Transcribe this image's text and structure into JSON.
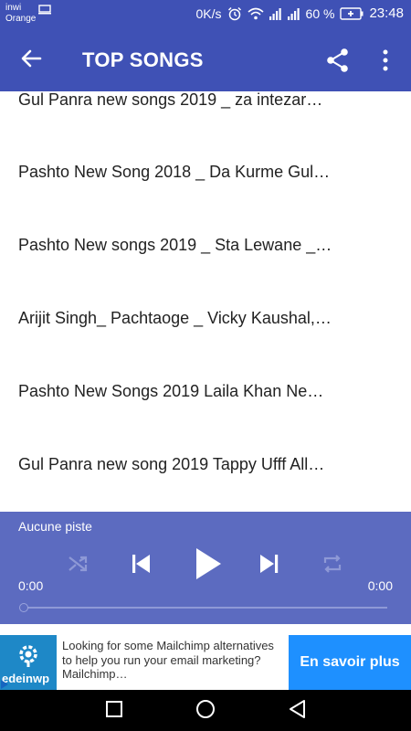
{
  "status_bar": {
    "carrier_line1": "inwi",
    "carrier_line2": "Orange",
    "network_speed": "0K/s",
    "battery": "60 %",
    "time": "23:48",
    "icons": [
      "screen-icon",
      "alarm-icon",
      "wifi-icon",
      "signal-icon",
      "signal-icon",
      "battery-icon"
    ]
  },
  "app_bar": {
    "title": "TOP SONGS",
    "back_icon": "arrow-left-icon",
    "share_icon": "share-icon",
    "more_icon": "more-vert-icon"
  },
  "songs": [
    "Gul Panra new songs 2019 _ za intezar…",
    "Pashto New Song 2018 _ Da Kurme Gul…",
    "Pashto New songs 2019 _ Sta Lewane _…",
    "Arijit Singh_ Pachtaoge _ Vicky Kaushal,…",
    "Pashto New Songs 2019 Laila Khan Ne…",
    "Gul Panra new song 2019 Tappy Ufff All…"
  ],
  "player": {
    "track_label": "Aucune piste",
    "current_time": "0:00",
    "total_time": "0:00",
    "progress": 0,
    "controls": [
      "shuffle-icon",
      "skip-previous-icon",
      "play-icon",
      "skip-next-icon",
      "repeat-icon"
    ]
  },
  "ad": {
    "logo_text": "edeinwp",
    "text": "Looking for some Mailchimp alternatives to help you run your email marketing? Mailchimp…",
    "cta": "En savoir plus"
  },
  "nav": [
    "recents-icon",
    "home-icon",
    "back-icon"
  ],
  "colors": {
    "primary": "#3f51b5",
    "player_bg": "#5c6bc0",
    "ad_cta": "#1e90ff",
    "ad_logo": "#1e88c7"
  }
}
